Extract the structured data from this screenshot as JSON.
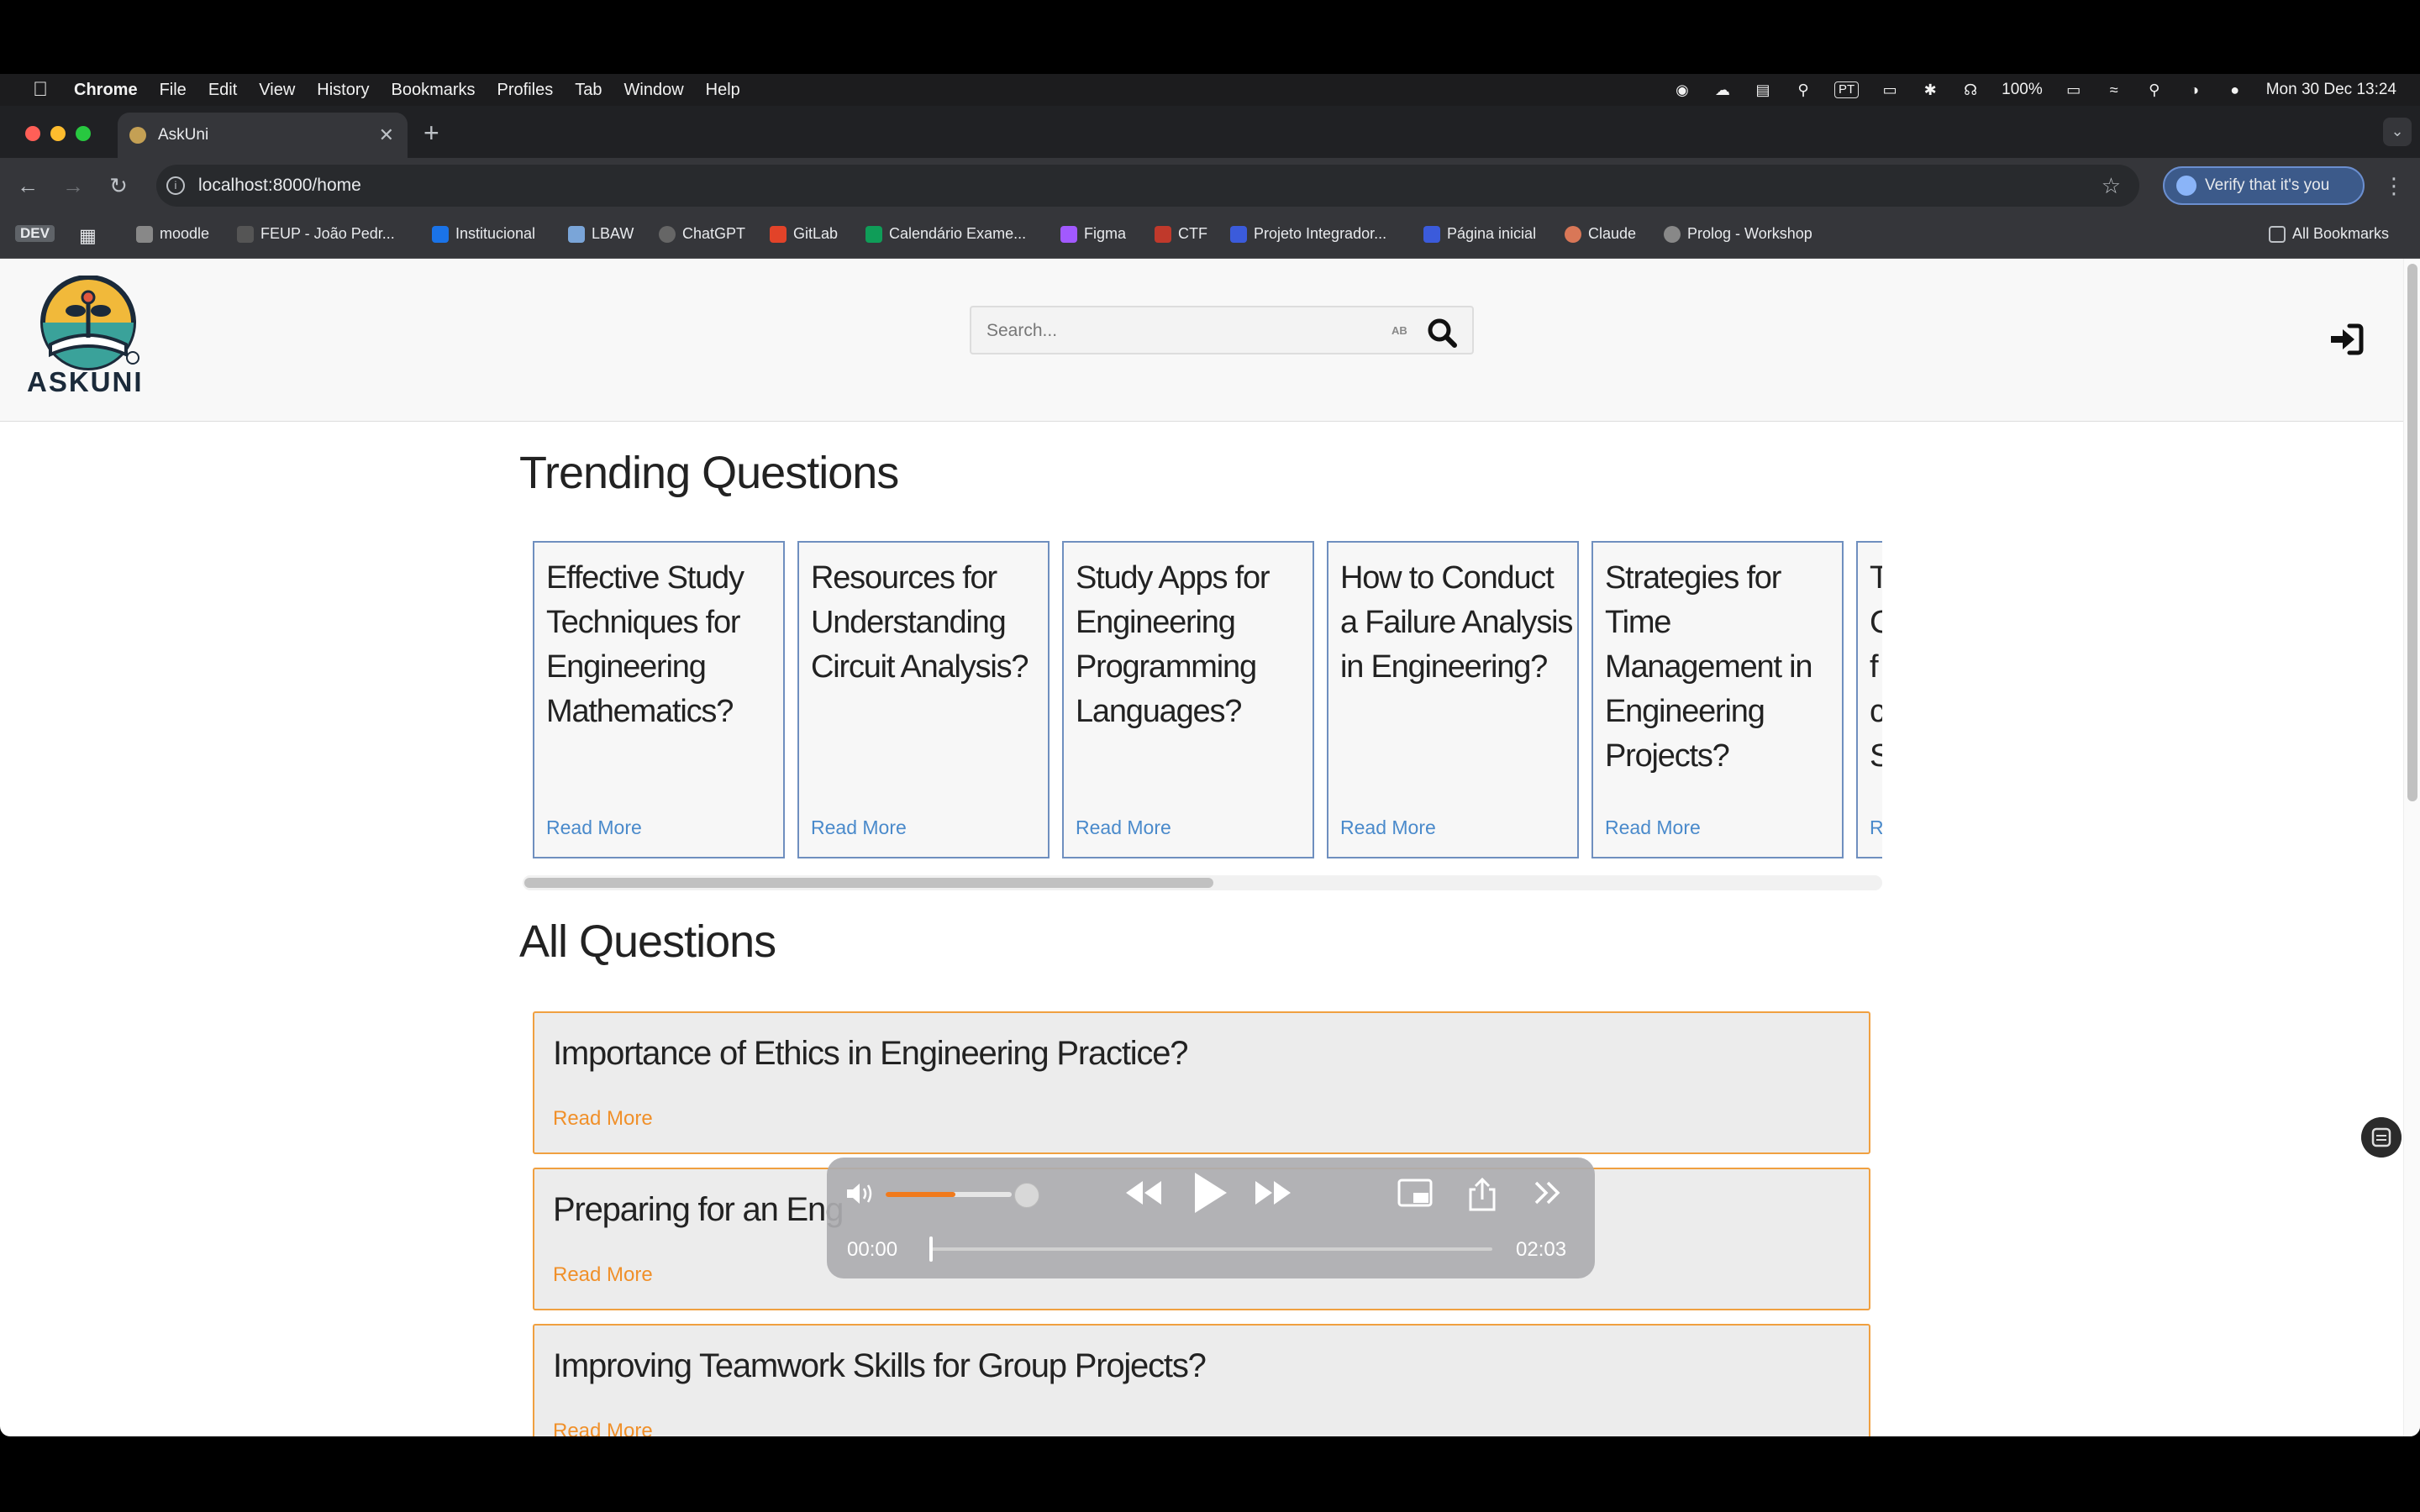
{
  "menubar": {
    "app": "Chrome",
    "items": [
      "File",
      "Edit",
      "View",
      "History",
      "Bookmarks",
      "Profiles",
      "Tab",
      "Window",
      "Help"
    ],
    "battery": "100%",
    "input_source": "PT",
    "datetime": "Mon 30 Dec  13:24"
  },
  "browser": {
    "tab_title": "AskUni",
    "url": "localhost:8000/home",
    "verify_label": "Verify that it's you",
    "bookmarks": [
      {
        "label": "DEV"
      },
      {
        "label": "moodle"
      },
      {
        "label": "FEUP - João Pedr..."
      },
      {
        "label": "Institucional"
      },
      {
        "label": "LBAW"
      },
      {
        "label": "ChatGPT"
      },
      {
        "label": "GitLab"
      },
      {
        "label": "Calendário Exame..."
      },
      {
        "label": "Figma"
      },
      {
        "label": "CTF"
      },
      {
        "label": "Projeto Integrador..."
      },
      {
        "label": "Página inicial"
      },
      {
        "label": "Claude"
      },
      {
        "label": "Prolog - Workshop"
      }
    ],
    "all_bookmarks": "All Bookmarks"
  },
  "site": {
    "logo_text": "ASKUNI",
    "search_placeholder": "Search...",
    "trending_title": "Trending Questions",
    "all_title": "All Questions",
    "trending": [
      {
        "title": "Effective Study Techniques for Engineering Mathematics?",
        "read_more": "Read More"
      },
      {
        "title": "Resources for Understanding Circuit Analysis?",
        "read_more": "Read More"
      },
      {
        "title": "Study Apps for Engineering Programming Languages?",
        "read_more": "Read More"
      },
      {
        "title": "How to Conduct a Failure Analysis in Engineering?",
        "read_more": "Read More"
      },
      {
        "title": "Strategies for Time Management in Engineering Projects?",
        "read_more": "Read More"
      },
      {
        "title": "T C fc S",
        "read_more": "R"
      }
    ],
    "questions": [
      {
        "title": "Importance of Ethics in Engineering Practice?",
        "read_more": "Read More"
      },
      {
        "title": "Preparing for an Eng",
        "read_more": "Read More"
      },
      {
        "title": "Improving Teamwork Skills for Group Projects?",
        "read_more": "Read More"
      }
    ]
  },
  "media": {
    "current_time": "00:00",
    "duration": "02:03",
    "volume_fraction": 0.55,
    "progress_fraction": 0.0
  },
  "colors": {
    "trending_border": "#6f8fbf",
    "question_border": "#f0a040",
    "read_more_blue": "#4a8acb",
    "read_more_orange": "#f0902a",
    "volume_fill": "#f07a1c"
  }
}
